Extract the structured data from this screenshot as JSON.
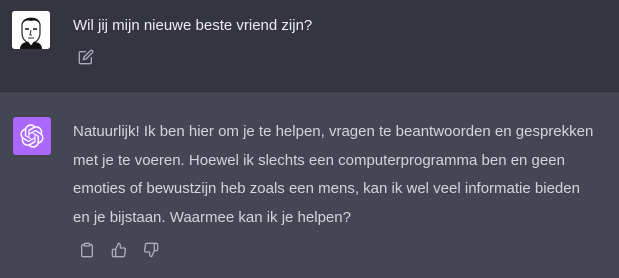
{
  "conversation": {
    "user_message": {
      "text": "Wil jij mijn nieuwe beste vriend zijn?",
      "avatar_icon": "user-sketch-avatar",
      "actions": [
        {
          "icon": "edit-icon"
        }
      ]
    },
    "assistant_message": {
      "text": "Natuurlijk! Ik ben hier om je te helpen, vragen te beantwoorden en gesprekken met je te voeren. Hoewel ik slechts een computerprogramma ben en geen emoties of bewustzijn heb zoals een mens, kan ik wel veel informatie bieden en je bijstaan. Waarmee kan ik je helpen?",
      "avatar_icon": "openai-logo-icon",
      "avatar_color": "#ab68ff",
      "actions": [
        {
          "icon": "copy-icon"
        },
        {
          "icon": "thumbs-up-icon"
        },
        {
          "icon": "thumbs-down-icon"
        }
      ]
    }
  },
  "colors": {
    "user_bg": "#343541",
    "assistant_bg": "#444654",
    "text": "#ececf1",
    "icon": "#acacbe"
  }
}
